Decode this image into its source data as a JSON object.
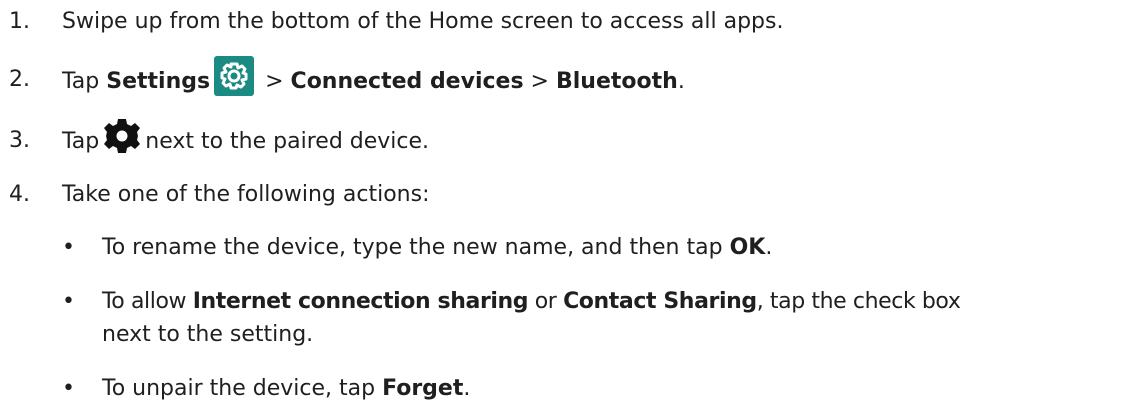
{
  "steps": [
    {
      "num": "1.",
      "text": "Swipe up from the bottom of the Home screen to access all apps."
    },
    {
      "num": "2.",
      "tap": "Tap",
      "settings": "Settings",
      "sep1": ">",
      "connected": "Connected devices",
      "sep2": ">",
      "bluetooth": "Bluetooth",
      "end": "."
    },
    {
      "num": "3.",
      "tap": "Tap",
      "rest": "next to the paired device."
    },
    {
      "num": "4.",
      "text": "Take one of the following actions:"
    }
  ],
  "bullets": [
    {
      "mark": "•",
      "pre": "To rename the device, type the new name, and then tap",
      "bold": "OK",
      "end": "."
    },
    {
      "mark": "•",
      "pre": "To allow",
      "bold1": "Internet connection sharing",
      "mid": "or",
      "bold2": "Contact Sharing",
      "post": ", tap the check box",
      "line2": "next to the setting."
    },
    {
      "mark": "•",
      "pre": "To unpair the device, tap",
      "bold": "Forget",
      "end": "."
    }
  ],
  "icons": {
    "settings_color": "#1a8a82",
    "gear_color": "#111111"
  }
}
